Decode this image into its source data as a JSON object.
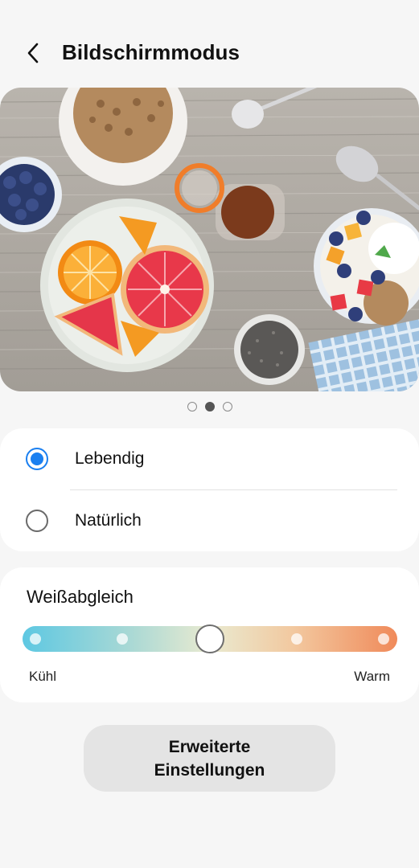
{
  "header": {
    "title": "Bildschirmmodus",
    "back_icon": "chevron-left-icon"
  },
  "preview": {
    "image_description_tag": "food-photo",
    "page_count": 3,
    "active_page": 2
  },
  "screen_mode": {
    "options": [
      {
        "label": "Lebendig",
        "selected": true
      },
      {
        "label": "Natürlich",
        "selected": false
      }
    ],
    "accent_color": "#1a7ff0"
  },
  "white_balance": {
    "title": "Weißabgleich",
    "min_label": "Kühl",
    "max_label": "Warm",
    "steps": 5,
    "value_fraction": 0.5,
    "gradient_colors": [
      "#5ec8e2",
      "#e9ead0",
      "#f08a5a"
    ]
  },
  "advanced_button": {
    "label": "Erweiterte\nEinstellungen"
  }
}
